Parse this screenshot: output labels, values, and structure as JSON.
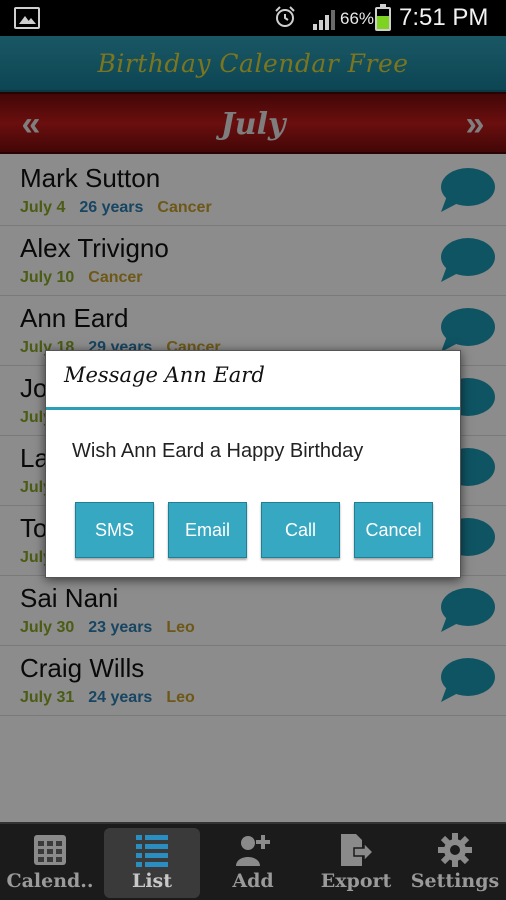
{
  "status_bar": {
    "battery_percent": "66%",
    "time": "7:51 PM",
    "battery_level": 0.66
  },
  "app_title": "Birthday Calendar Free",
  "month_nav": {
    "prev": "«",
    "next": "»",
    "month": "July"
  },
  "contacts": [
    {
      "name": "Mark Sutton",
      "date": "July 4",
      "age": "26 years",
      "sign": "Cancer"
    },
    {
      "name": "Alex Trivigno",
      "date": "July 10",
      "age": "",
      "sign": "Cancer"
    },
    {
      "name": "Ann Eard",
      "date": "July 18",
      "age": "29 years",
      "sign": "Cancer"
    },
    {
      "name": "Jo",
      "date": "July",
      "age": "",
      "sign": ""
    },
    {
      "name": "La",
      "date": "July",
      "age": "",
      "sign": ""
    },
    {
      "name": "To",
      "date": "July",
      "age": "",
      "sign": ""
    },
    {
      "name": "Sai Nani",
      "date": "July 30",
      "age": "23 years",
      "sign": "Leo"
    },
    {
      "name": "Craig Wills",
      "date": "July 31",
      "age": "24 years",
      "sign": "Leo"
    }
  ],
  "dialog": {
    "title": "Message Ann Eard",
    "message": "Wish Ann Eard a Happy Birthday",
    "buttons": {
      "sms": "SMS",
      "email": "Email",
      "call": "Call",
      "cancel": "Cancel"
    }
  },
  "tabs": [
    {
      "label": "Calend..",
      "icon": "calendar-icon"
    },
    {
      "label": "List",
      "icon": "list-icon"
    },
    {
      "label": "Add",
      "icon": "add-contact-icon"
    },
    {
      "label": "Export",
      "icon": "export-icon"
    },
    {
      "label": "Settings",
      "icon": "gear-icon"
    }
  ],
  "colors": {
    "title_bar": "#2f9fb7",
    "title_text": "#e1d53a",
    "month_bar": "#c21b1b",
    "date_text": "#89a825",
    "age_text": "#2a7fb3",
    "sign_text": "#c9a02a",
    "accent": "#36a8c2"
  }
}
